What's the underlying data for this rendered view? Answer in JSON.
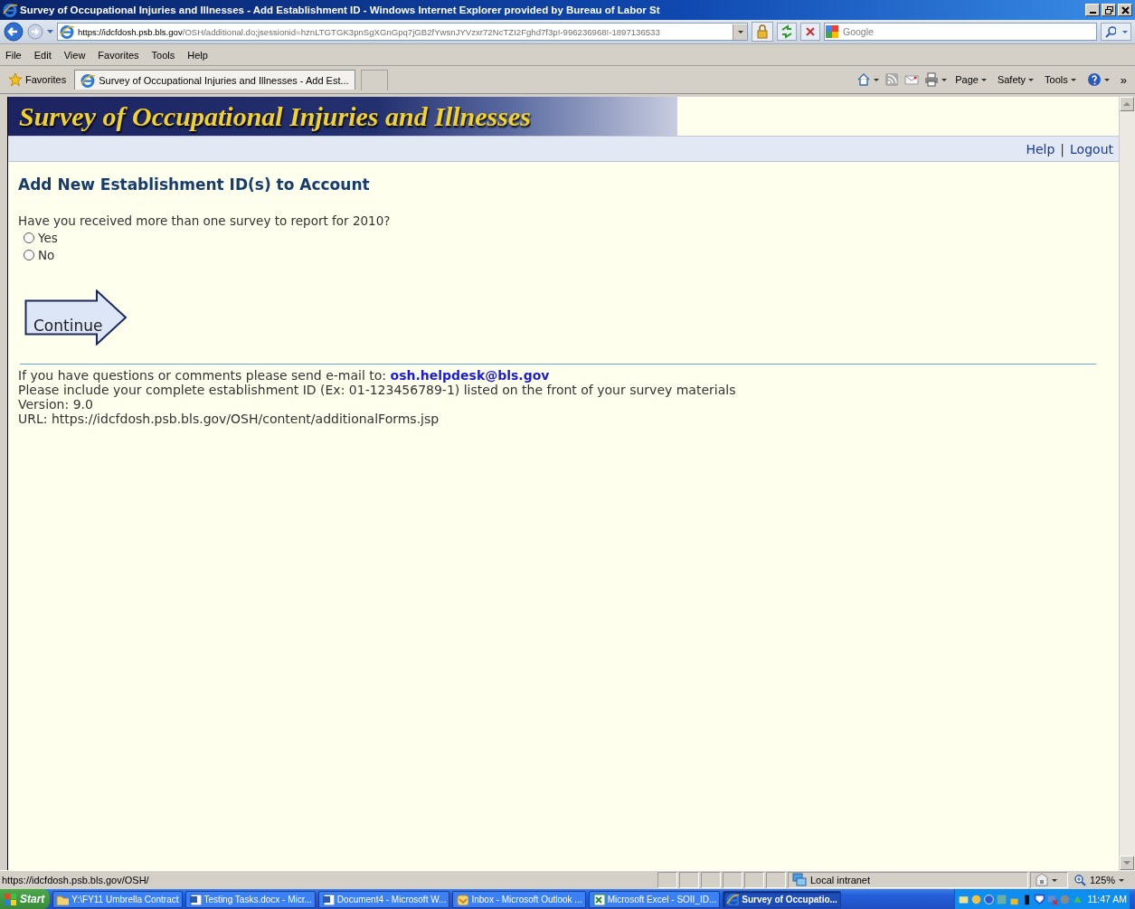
{
  "window": {
    "title": "Survey of Occupational Injuries and Illnesses - Add Establishment ID - Windows Internet Explorer provided by Bureau of Labor St"
  },
  "address_bar": {
    "host": "https://idcfdosh.psb.bls.gov",
    "path": "/OSH/additional.do;jsessionid=hznLTGTGK3pnSgXGnGpq7jGB2fYwsnJYVzxr72NcTZI2Fghd7f3p!-996236968!-1897136533",
    "search_placeholder": "Google"
  },
  "menu": [
    "File",
    "Edit",
    "View",
    "Favorites",
    "Tools",
    "Help"
  ],
  "favorites_bar": {
    "label": "Favorites",
    "tabs": [
      {
        "label": "Survey of Occupational Injuries and Illnesses - Add Est...",
        "selected": true
      }
    ],
    "commands": [
      "Page",
      "Safety",
      "Tools"
    ],
    "more": "»"
  },
  "page": {
    "banner_title": "Survey of Occupational Injuries and Illnesses",
    "nav_links": [
      "Help",
      "Logout"
    ],
    "nav_separator": "|",
    "heading": "Add New Establishment ID(s) to Account",
    "question": "Have you received more than one survey to report for 2010?",
    "options": [
      {
        "label": "Yes",
        "selected": false
      },
      {
        "label": "No",
        "selected": false
      }
    ],
    "continue_button": "Continue",
    "contact_text": "If you have questions or comments please send e-mail to:",
    "contact_email": "osh.helpdesk@bls.gov",
    "footer_lines": [
      "Please include your complete establishment ID (Ex: 01-123456789-1) listed on the front of your survey materials",
      "Version: 9.0",
      "URL: https://idcfdosh.psb.bls.gov/OSH/content/additionalForms.jsp"
    ]
  },
  "status_bar": {
    "url": "https://idcfdosh.psb.bls.gov/OSH/",
    "zone": "Local intranet",
    "zoom": "125%"
  },
  "taskbar": {
    "start": "Start",
    "tasks": [
      {
        "label": "Y:\\FY11 Umbrella Contract",
        "kind": "folder",
        "selected": false
      },
      {
        "label": "Testing Tasks.docx - Micr...",
        "kind": "word",
        "selected": false
      },
      {
        "label": "Document4 - Microsoft W...",
        "kind": "word",
        "selected": false
      },
      {
        "label": "Inbox - Microsoft Outlook ...",
        "kind": "outlook",
        "selected": false
      },
      {
        "label": "Microsoft Excel - SOII_ID...",
        "kind": "excel",
        "selected": false
      },
      {
        "label": "Survey of Occupatio...",
        "kind": "ie",
        "selected": true
      }
    ],
    "clock": "11:47 AM"
  }
}
